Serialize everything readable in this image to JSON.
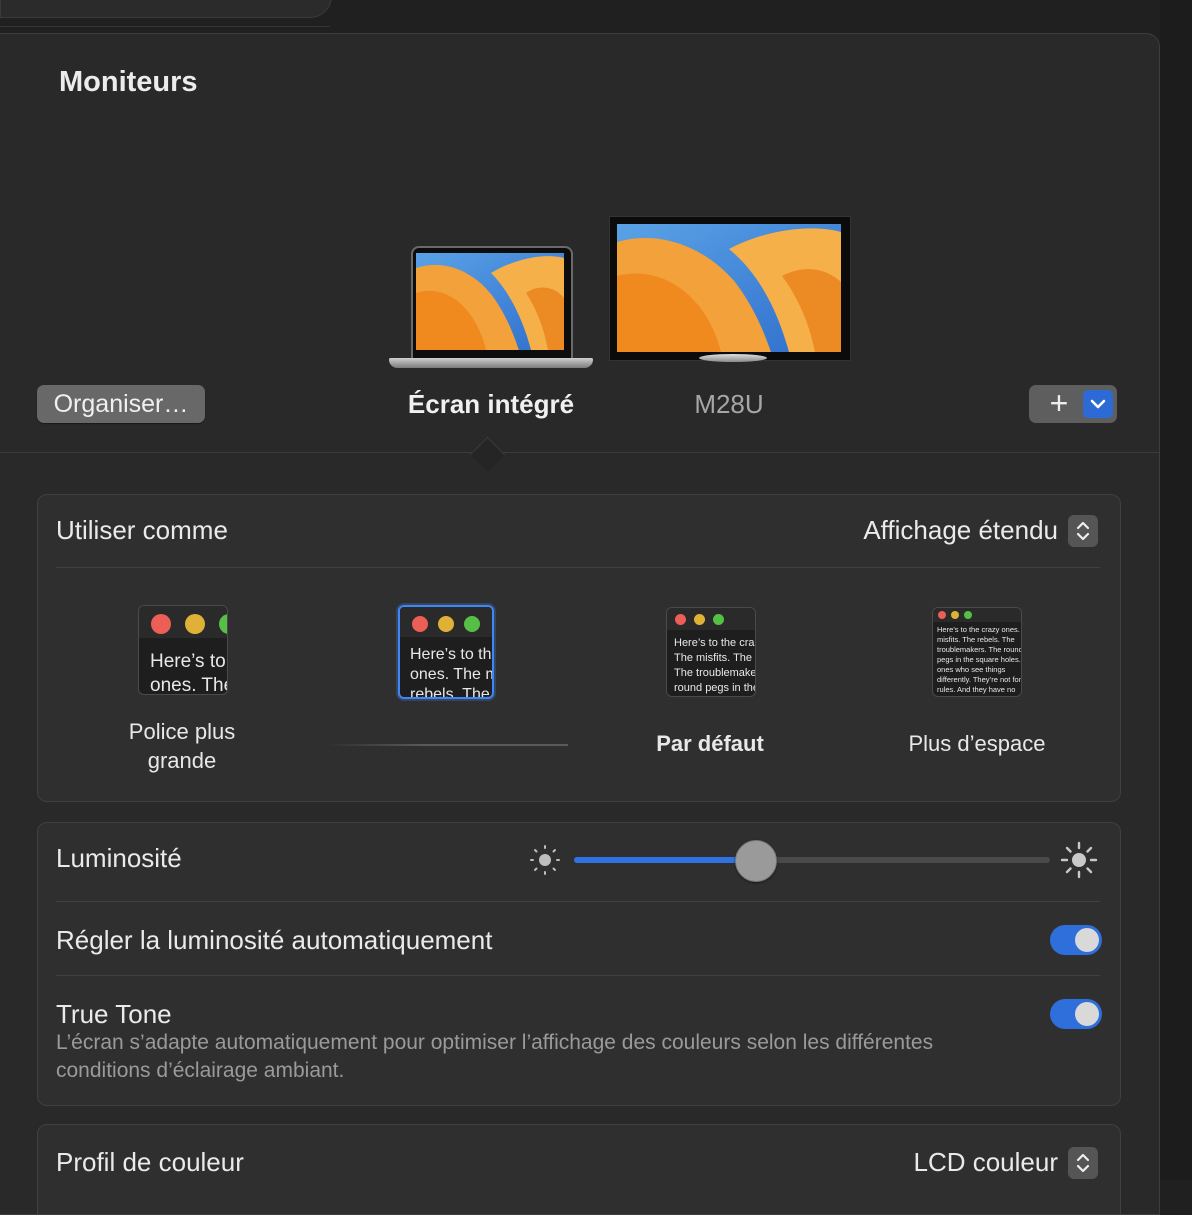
{
  "window": {
    "title": "Moniteurs"
  },
  "arrangement": {
    "organise_label": "Organiser…",
    "displays": [
      {
        "name": "Écran intégré",
        "selected": true
      },
      {
        "name": "M28U",
        "selected": false
      }
    ],
    "add_label": "+"
  },
  "use_as": {
    "label": "Utiliser comme",
    "value": "Affichage étendu",
    "resolution_options": [
      {
        "label": "Police plus grande",
        "selected": false,
        "sample_text": "Here’s to the crazy ones. The misfits. The rebels. The troublemakers."
      },
      {
        "label": "",
        "selected": true,
        "sample_text": "Here’s to the crazy ones. The misfits. The rebels. The troublemakers. The round pegs in the square holes. The ones who see things differently."
      },
      {
        "label": "Par défaut",
        "selected": false,
        "sample_text": "Here’s to the crazy ones. The misfits. The rebels. The troublemakers. The round pegs in the square holes. The ones who see things differently. They’re not fond of rules. And they have no respect for the status quo."
      },
      {
        "label": "Plus d’espace",
        "selected": false,
        "sample_text": "Here’s to the crazy ones. The misfits. The rebels. The troublemakers. The round pegs in the square holes. The ones who see things differently. They’re not fond of rules. And they have no respect for the status quo. You can quote them, disagree with them, glorify or vilify them. About the only thing you can’t do is ignore them. Because they change things."
      }
    ]
  },
  "brightness": {
    "label": "Luminosité",
    "value": 0.38,
    "auto_label": "Régler la luminosité automatiquement",
    "auto_enabled": true,
    "true_tone_label": "True Tone",
    "true_tone_enabled": true,
    "true_tone_description": "L’écran s’adapte automatiquement pour optimiser l’affichage des couleurs selon les différentes conditions d’éclairage ambiant."
  },
  "color_profile": {
    "label": "Profil de couleur",
    "value": "LCD couleur"
  },
  "colors": {
    "accent": "#2f73e3",
    "traffic_red": "#ec5f57",
    "traffic_yellow": "#dfb237",
    "traffic_green": "#56c046"
  }
}
